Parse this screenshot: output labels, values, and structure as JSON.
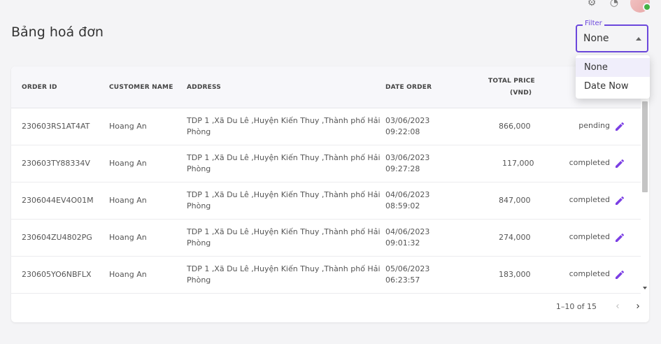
{
  "page": {
    "title": "Bảng hoá đơn"
  },
  "filter": {
    "label": "Filter",
    "value": "None",
    "options": [
      "None",
      "Date Now"
    ],
    "accent": "#6b47dc"
  },
  "table": {
    "headers": {
      "order_id": "ORDER ID",
      "customer_name": "CUSTOMER NAME",
      "address": "ADDRESS",
      "date_order": "DATE ORDER",
      "total_price_1": "TOTAL PRICE",
      "total_price_2": "(VND)"
    },
    "rows": [
      {
        "order_id": "230603RS1AT4AT",
        "customer": "Hoang An",
        "address_1": "TDP 1 ,Xã Du Lê ,Huyện Kiến Thuy ,Thành phố Hải",
        "address_2": "Phòng",
        "date": "03/06/2023",
        "time": "09:22:08",
        "total": "866,000",
        "status": "pending"
      },
      {
        "order_id": "230603TY88334V",
        "customer": "Hoang An",
        "address_1": "TDP 1 ,Xã Du Lê ,Huyện Kiến Thuy ,Thành phố Hải",
        "address_2": "Phòng",
        "date": "03/06/2023",
        "time": "09:27:28",
        "total": "117,000",
        "status": "completed"
      },
      {
        "order_id": "2306044EV4O01M",
        "customer": "Hoang An",
        "address_1": "TDP 1 ,Xã Du Lê ,Huyện Kiến Thuy ,Thành phố Hải",
        "address_2": "Phòng",
        "date": "04/06/2023",
        "time": "08:59:02",
        "total": "847,000",
        "status": "completed"
      },
      {
        "order_id": "230604ZU4802PG",
        "customer": "Hoang An",
        "address_1": "TDP 1 ,Xã Du Lê ,Huyện Kiến Thuy ,Thành phố Hải",
        "address_2": "Phòng",
        "date": "04/06/2023",
        "time": "09:01:32",
        "total": "274,000",
        "status": "completed"
      },
      {
        "order_id": "230605YO6NBFLX",
        "customer": "Hoang An",
        "address_1": "TDP 1 ,Xã Du Lê ,Huyện Kiến Thuy ,Thành phố Hải",
        "address_2": "Phòng",
        "date": "05/06/2023",
        "time": "06:23:57",
        "total": "183,000",
        "status": "completed"
      }
    ]
  },
  "pagination": {
    "range": "1–10 of 15"
  },
  "colors": {
    "accent": "#6b47dc",
    "online": "#43b244"
  }
}
